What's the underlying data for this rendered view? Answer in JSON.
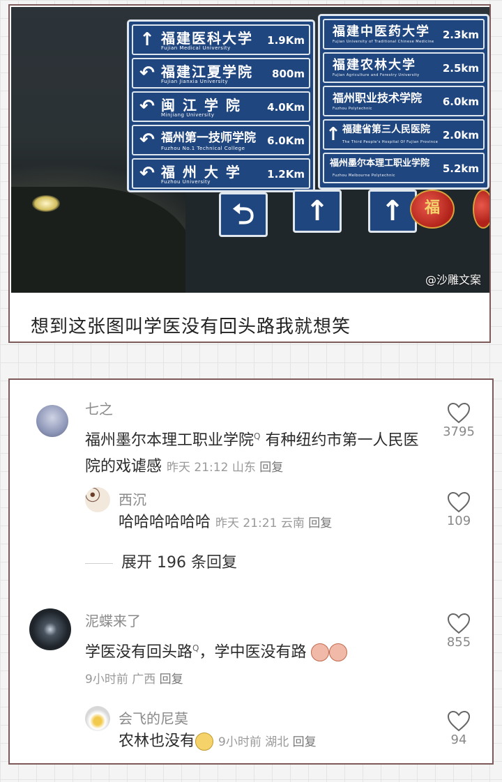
{
  "post": {
    "caption": "想到这张图叫学医没有回头路我就想笑",
    "watermark": "@沙雕文案",
    "left_sign": [
      {
        "arrow": "↑",
        "zh": "福建医科大学",
        "en": "Fujian Medical University",
        "dist": "1.9Km"
      },
      {
        "arrow": "↶",
        "zh": "福建江夏学院",
        "en": "Fujian Jianxia University",
        "dist": "800m"
      },
      {
        "arrow": "↶",
        "zh": "闽 江 学 院",
        "en": "Minjiang University",
        "dist": "4.0Km"
      },
      {
        "arrow": "↶",
        "zh": "福州第一技师学院",
        "en": "Fuzhou No.1 Technical College",
        "dist": "6.0Km"
      },
      {
        "arrow": "↶",
        "zh": "福 州 大 学",
        "en": "Fuzhou University",
        "dist": "1.2Km"
      }
    ],
    "right_sign": [
      {
        "arrow": "",
        "zh": "福建中医药大学",
        "en": "Fujian University of Traditional Chinese Medicine",
        "dist": "2.3km"
      },
      {
        "arrow": "",
        "zh": "福建农林大学",
        "en": "Fujian Agriculture and Forestry University",
        "dist": "2.5km"
      },
      {
        "arrow": "",
        "zh": "福州职业技术学院",
        "en": "Fuzhou Polytechnic",
        "dist": "6.0km"
      },
      {
        "arrow": "↑",
        "zh": "福建省第三人民医院",
        "en": "The Third People's Hospital Of Fujian Province",
        "dist": "2.0km"
      },
      {
        "arrow": "",
        "zh": "福州墨尔本理工职业学院",
        "en": "Fuzhou Melbourne Polytechnic",
        "dist": "5.2km"
      }
    ],
    "lantern_char": "福"
  },
  "comments": [
    {
      "user": "七之",
      "text": "福州墨尔本理工职业学院",
      "text_rest": " 有种纽约市第一人民医院的戏谑感",
      "time": "昨天 21:12",
      "location": "山东",
      "reply": "回复",
      "likes": "3795"
    },
    {
      "user": "西沉",
      "text": "哈哈哈哈哈哈",
      "time": "昨天 21:21",
      "location": "云南",
      "reply": "回复",
      "likes": "109"
    },
    {
      "user": "泥蝶来了",
      "text": "学医没有回头路",
      "text_rest": "，学中医没有路",
      "time": "9小时前",
      "location": "广西",
      "reply": "回复",
      "likes": "855"
    },
    {
      "user": "会飞的尼莫",
      "text": "农林也没有",
      "time": "9小时前",
      "location": "湖北",
      "reply": "回复",
      "likes": "94"
    }
  ],
  "expand_replies": "展开 196 条回复",
  "search_mark": "Q",
  "icons": {
    "like": "heart-outline-icon",
    "arrow_up": "arrow-up-icon",
    "u_turn": "u-turn-icon"
  }
}
